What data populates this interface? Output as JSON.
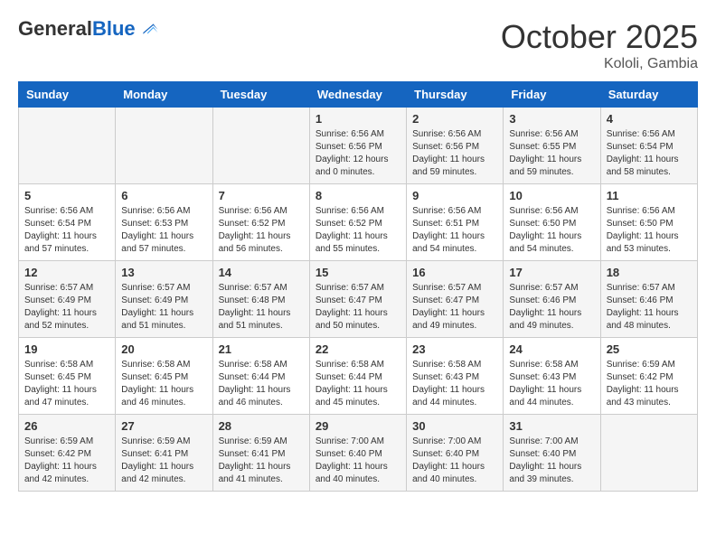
{
  "header": {
    "logo_general": "General",
    "logo_blue": "Blue",
    "month_title": "October 2025",
    "location": "Kololi, Gambia"
  },
  "weekdays": [
    "Sunday",
    "Monday",
    "Tuesday",
    "Wednesday",
    "Thursday",
    "Friday",
    "Saturday"
  ],
  "weeks": [
    [
      {
        "day": "",
        "sunrise": "",
        "sunset": "",
        "daylight": ""
      },
      {
        "day": "",
        "sunrise": "",
        "sunset": "",
        "daylight": ""
      },
      {
        "day": "",
        "sunrise": "",
        "sunset": "",
        "daylight": ""
      },
      {
        "day": "1",
        "sunrise": "Sunrise: 6:56 AM",
        "sunset": "Sunset: 6:56 PM",
        "daylight": "Daylight: 12 hours and 0 minutes."
      },
      {
        "day": "2",
        "sunrise": "Sunrise: 6:56 AM",
        "sunset": "Sunset: 6:56 PM",
        "daylight": "Daylight: 11 hours and 59 minutes."
      },
      {
        "day": "3",
        "sunrise": "Sunrise: 6:56 AM",
        "sunset": "Sunset: 6:55 PM",
        "daylight": "Daylight: 11 hours and 59 minutes."
      },
      {
        "day": "4",
        "sunrise": "Sunrise: 6:56 AM",
        "sunset": "Sunset: 6:54 PM",
        "daylight": "Daylight: 11 hours and 58 minutes."
      }
    ],
    [
      {
        "day": "5",
        "sunrise": "Sunrise: 6:56 AM",
        "sunset": "Sunset: 6:54 PM",
        "daylight": "Daylight: 11 hours and 57 minutes."
      },
      {
        "day": "6",
        "sunrise": "Sunrise: 6:56 AM",
        "sunset": "Sunset: 6:53 PM",
        "daylight": "Daylight: 11 hours and 57 minutes."
      },
      {
        "day": "7",
        "sunrise": "Sunrise: 6:56 AM",
        "sunset": "Sunset: 6:52 PM",
        "daylight": "Daylight: 11 hours and 56 minutes."
      },
      {
        "day": "8",
        "sunrise": "Sunrise: 6:56 AM",
        "sunset": "Sunset: 6:52 PM",
        "daylight": "Daylight: 11 hours and 55 minutes."
      },
      {
        "day": "9",
        "sunrise": "Sunrise: 6:56 AM",
        "sunset": "Sunset: 6:51 PM",
        "daylight": "Daylight: 11 hours and 54 minutes."
      },
      {
        "day": "10",
        "sunrise": "Sunrise: 6:56 AM",
        "sunset": "Sunset: 6:50 PM",
        "daylight": "Daylight: 11 hours and 54 minutes."
      },
      {
        "day": "11",
        "sunrise": "Sunrise: 6:56 AM",
        "sunset": "Sunset: 6:50 PM",
        "daylight": "Daylight: 11 hours and 53 minutes."
      }
    ],
    [
      {
        "day": "12",
        "sunrise": "Sunrise: 6:57 AM",
        "sunset": "Sunset: 6:49 PM",
        "daylight": "Daylight: 11 hours and 52 minutes."
      },
      {
        "day": "13",
        "sunrise": "Sunrise: 6:57 AM",
        "sunset": "Sunset: 6:49 PM",
        "daylight": "Daylight: 11 hours and 51 minutes."
      },
      {
        "day": "14",
        "sunrise": "Sunrise: 6:57 AM",
        "sunset": "Sunset: 6:48 PM",
        "daylight": "Daylight: 11 hours and 51 minutes."
      },
      {
        "day": "15",
        "sunrise": "Sunrise: 6:57 AM",
        "sunset": "Sunset: 6:47 PM",
        "daylight": "Daylight: 11 hours and 50 minutes."
      },
      {
        "day": "16",
        "sunrise": "Sunrise: 6:57 AM",
        "sunset": "Sunset: 6:47 PM",
        "daylight": "Daylight: 11 hours and 49 minutes."
      },
      {
        "day": "17",
        "sunrise": "Sunrise: 6:57 AM",
        "sunset": "Sunset: 6:46 PM",
        "daylight": "Daylight: 11 hours and 49 minutes."
      },
      {
        "day": "18",
        "sunrise": "Sunrise: 6:57 AM",
        "sunset": "Sunset: 6:46 PM",
        "daylight": "Daylight: 11 hours and 48 minutes."
      }
    ],
    [
      {
        "day": "19",
        "sunrise": "Sunrise: 6:58 AM",
        "sunset": "Sunset: 6:45 PM",
        "daylight": "Daylight: 11 hours and 47 minutes."
      },
      {
        "day": "20",
        "sunrise": "Sunrise: 6:58 AM",
        "sunset": "Sunset: 6:45 PM",
        "daylight": "Daylight: 11 hours and 46 minutes."
      },
      {
        "day": "21",
        "sunrise": "Sunrise: 6:58 AM",
        "sunset": "Sunset: 6:44 PM",
        "daylight": "Daylight: 11 hours and 46 minutes."
      },
      {
        "day": "22",
        "sunrise": "Sunrise: 6:58 AM",
        "sunset": "Sunset: 6:44 PM",
        "daylight": "Daylight: 11 hours and 45 minutes."
      },
      {
        "day": "23",
        "sunrise": "Sunrise: 6:58 AM",
        "sunset": "Sunset: 6:43 PM",
        "daylight": "Daylight: 11 hours and 44 minutes."
      },
      {
        "day": "24",
        "sunrise": "Sunrise: 6:58 AM",
        "sunset": "Sunset: 6:43 PM",
        "daylight": "Daylight: 11 hours and 44 minutes."
      },
      {
        "day": "25",
        "sunrise": "Sunrise: 6:59 AM",
        "sunset": "Sunset: 6:42 PM",
        "daylight": "Daylight: 11 hours and 43 minutes."
      }
    ],
    [
      {
        "day": "26",
        "sunrise": "Sunrise: 6:59 AM",
        "sunset": "Sunset: 6:42 PM",
        "daylight": "Daylight: 11 hours and 42 minutes."
      },
      {
        "day": "27",
        "sunrise": "Sunrise: 6:59 AM",
        "sunset": "Sunset: 6:41 PM",
        "daylight": "Daylight: 11 hours and 42 minutes."
      },
      {
        "day": "28",
        "sunrise": "Sunrise: 6:59 AM",
        "sunset": "Sunset: 6:41 PM",
        "daylight": "Daylight: 11 hours and 41 minutes."
      },
      {
        "day": "29",
        "sunrise": "Sunrise: 7:00 AM",
        "sunset": "Sunset: 6:40 PM",
        "daylight": "Daylight: 11 hours and 40 minutes."
      },
      {
        "day": "30",
        "sunrise": "Sunrise: 7:00 AM",
        "sunset": "Sunset: 6:40 PM",
        "daylight": "Daylight: 11 hours and 40 minutes."
      },
      {
        "day": "31",
        "sunrise": "Sunrise: 7:00 AM",
        "sunset": "Sunset: 6:40 PM",
        "daylight": "Daylight: 11 hours and 39 minutes."
      },
      {
        "day": "",
        "sunrise": "",
        "sunset": "",
        "daylight": ""
      }
    ]
  ]
}
